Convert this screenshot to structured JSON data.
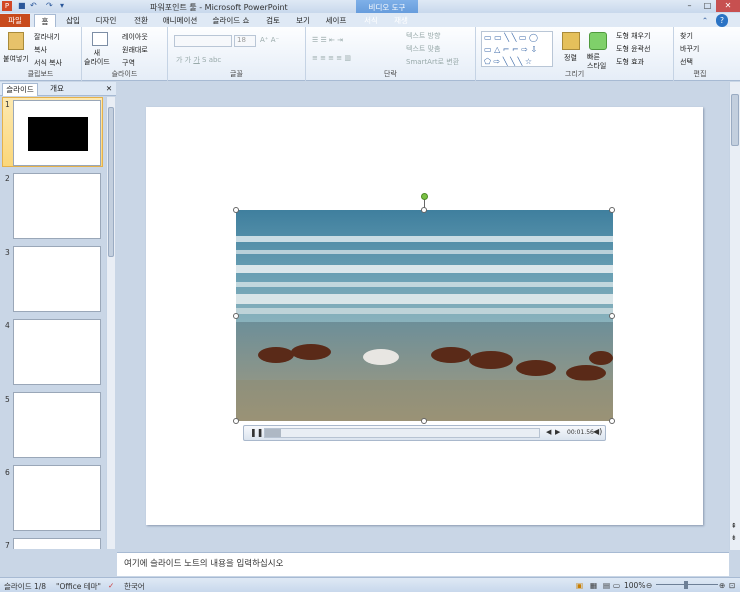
{
  "window": {
    "title": "파워포인트 툴 - Microsoft PowerPoint",
    "context_tab": "비디오 도구",
    "min": "–",
    "max": "□",
    "close": "✕"
  },
  "qat": {
    "app": "P",
    "save": "■",
    "undo": "↶",
    "redo": "↷",
    "more": "▾"
  },
  "tabs": [
    {
      "label": "파일"
    },
    {
      "label": "홈"
    },
    {
      "label": "삽입"
    },
    {
      "label": "디자인"
    },
    {
      "label": "전환"
    },
    {
      "label": "애니메이션"
    },
    {
      "label": "슬라이드 쇼"
    },
    {
      "label": "검토"
    },
    {
      "label": "보기"
    },
    {
      "label": "세이프"
    },
    {
      "label": "서식"
    },
    {
      "label": "재생"
    }
  ],
  "ribbon": {
    "clipboard": {
      "label": "클립보드",
      "paste": "붙여넣기",
      "cut": "잘라내기",
      "copy": "복사",
      "format_copy": "서식 복사"
    },
    "slides": {
      "label": "슬라이드",
      "new_slide": "새\n슬라이드",
      "layout": "레이아웃",
      "reset": "원래대로",
      "section": "구역"
    },
    "font": {
      "label": "글꼴",
      "size": "18"
    },
    "paragraph": {
      "label": "단락",
      "text_dir": "텍스트 방향",
      "text_align": "텍스트 맞춤",
      "smartart": "SmartArt로 변환"
    },
    "drawing": {
      "label": "그리기",
      "arrange": "정렬",
      "quick_styles": "빠른\n스타일",
      "fill": "도형 채우기",
      "outline": "도형 윤곽선",
      "effects": "도형 효과"
    },
    "editing": {
      "label": "편집",
      "find": "찾기",
      "replace": "바꾸기",
      "select": "선택"
    }
  },
  "panel": {
    "tab_slides": "슬라이드",
    "tab_outline": "개요",
    "close": "✕",
    "slides": [
      "1",
      "2",
      "3",
      "4",
      "5",
      "6",
      "7"
    ]
  },
  "video": {
    "time": "00:01.56",
    "play": "❚❚"
  },
  "notes": {
    "placeholder": "여기에 슬라이드 노트의 내용을 입력하십시오"
  },
  "status": {
    "slide": "슬라이드 1/8",
    "theme": "\"Office 테마\"",
    "lang": "한국어",
    "zoom": "100%"
  },
  "colors": {
    "file_tab": "#c84a1c",
    "context": "#4d88d0",
    "selected_thumb": "#fbd77a"
  }
}
